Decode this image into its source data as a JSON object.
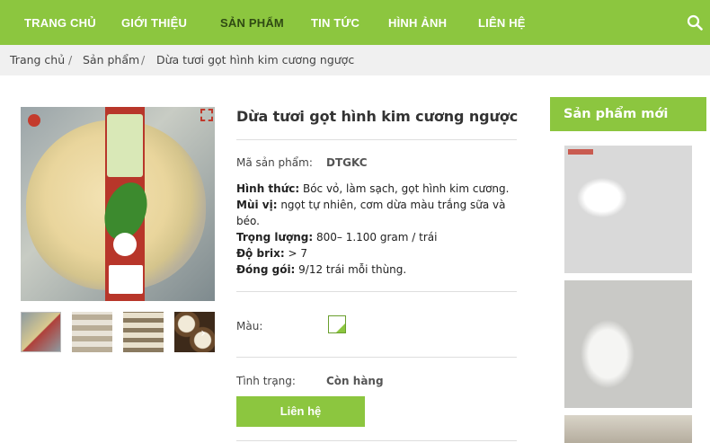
{
  "nav": {
    "items": [
      {
        "label": "TRANG CHỦ",
        "active": false
      },
      {
        "label": "GIỚI THIỆU",
        "active": false
      },
      {
        "label": "SẢN PHẨM",
        "active": true
      },
      {
        "label": "TIN TỨC",
        "active": false
      },
      {
        "label": "HÌNH ẢNH",
        "active": false
      },
      {
        "label": "LIÊN HỆ",
        "active": false
      }
    ],
    "search_icon": "search-icon",
    "bg_color": "#8cc63f",
    "active_color": "#2f4a13"
  },
  "breadcrumb": {
    "items": [
      "Trang chủ",
      "Sản phẩm",
      "Dừa tươi gọt hình kim cương ngược"
    ],
    "separator": "/"
  },
  "product": {
    "title": "Dừa tươi gọt hình kim cương ngược",
    "sku_label": "Mã sản phẩm:",
    "sku_value": "DTGKC",
    "details": [
      {
        "label": "Hình thức:",
        "value": " Bóc vỏ, làm sạch, gọt hình kim cương."
      },
      {
        "label": "Mùi vị:",
        "value": " ngọt tự nhiên, cơm dừa màu trắng sữa và béo."
      },
      {
        "label": "Trọng lượng:",
        "value": "  800– 1.100 gram / trái"
      },
      {
        "label": "Độ brix:",
        "value": " > 7"
      },
      {
        "label": "Đóng gói:",
        "value": " 9/12 trái mỗi thùng."
      }
    ],
    "color_label": "Màu:",
    "status_label": "Tình trạng:",
    "status_value": "Còn hàng",
    "contact_button": "Liên hệ"
  },
  "gallery": {
    "thumb_count": 4,
    "next_arrow": "›"
  },
  "sidebar": {
    "title": "Sản phẩm mới"
  },
  "colors": {
    "accent": "#8cc63f",
    "text": "#333333",
    "breadcrumb_bg": "#f0f0f0"
  }
}
